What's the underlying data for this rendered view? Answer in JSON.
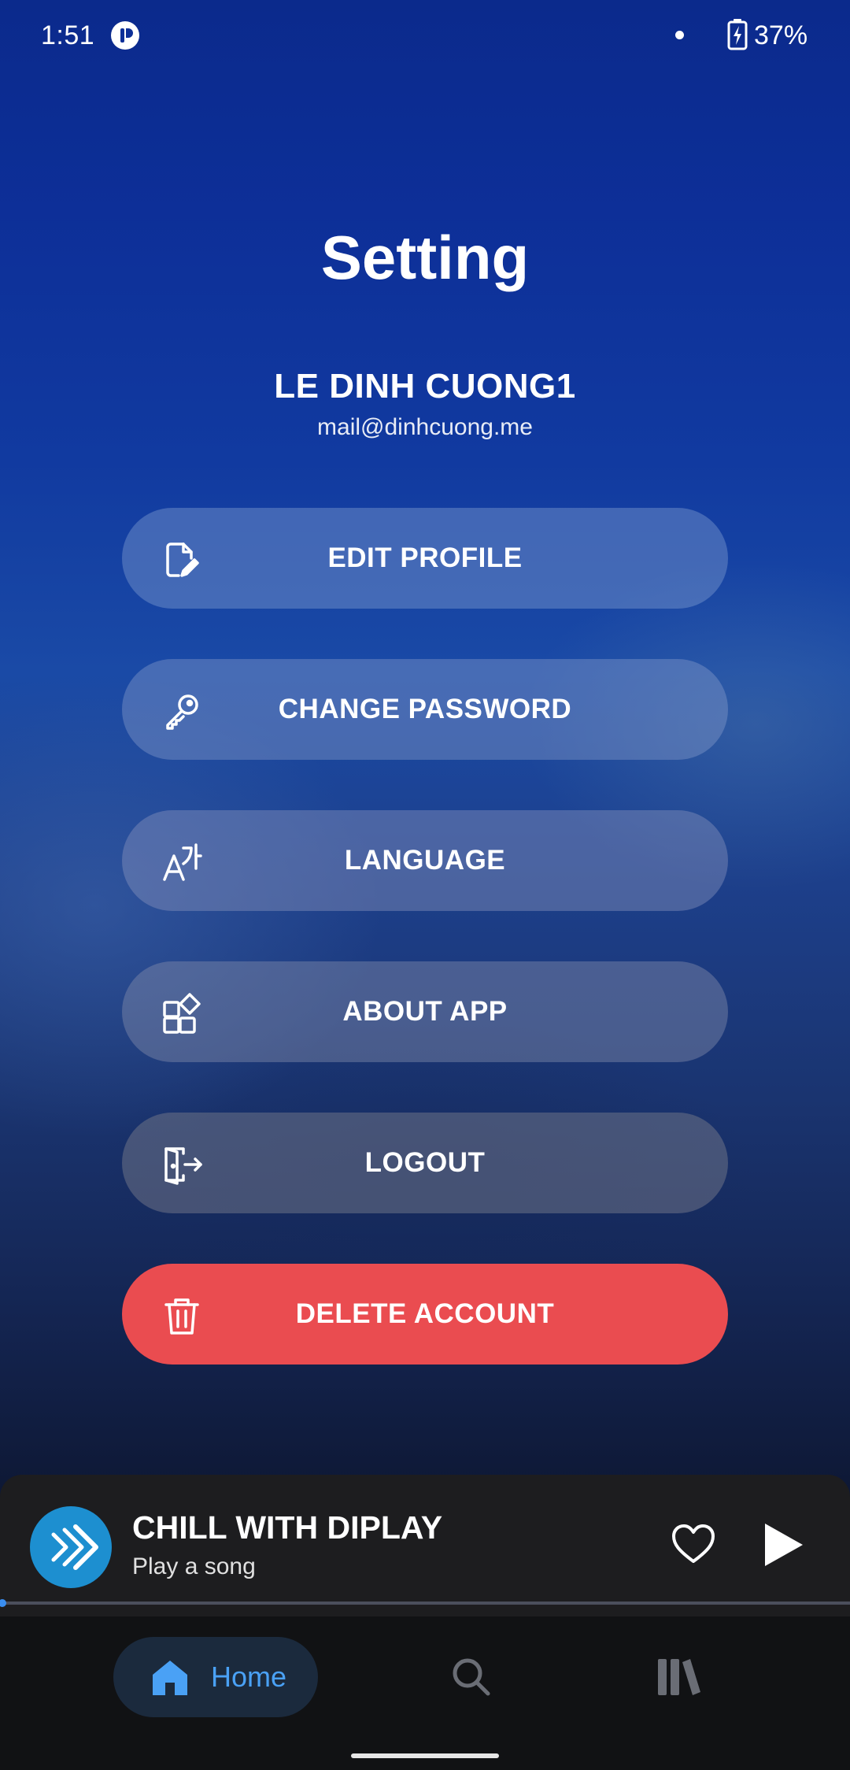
{
  "status_bar": {
    "time": "1:51",
    "battery": "37%",
    "icons": [
      "app-notification-icon",
      "dot-icon",
      "battery-charging-icon"
    ]
  },
  "page": {
    "title": "Setting"
  },
  "user": {
    "name": "LE DINH CUONG1",
    "email": "mail@dinhcuong.me"
  },
  "menu": {
    "items": [
      {
        "label": "EDIT PROFILE",
        "icon": "edit-document-icon"
      },
      {
        "label": "CHANGE PASSWORD",
        "icon": "key-icon"
      },
      {
        "label": "LANGUAGE",
        "icon": "translate-icon"
      },
      {
        "label": "ABOUT APP",
        "icon": "widgets-icon"
      },
      {
        "label": "LOGOUT",
        "icon": "logout-icon"
      },
      {
        "label": "DELETE ACCOUNT",
        "icon": "trash-icon"
      }
    ]
  },
  "player": {
    "title": "CHILL WITH DIPLAY",
    "subtitle": "Play a song",
    "progress": 0,
    "icons": [
      "app-logo-icon",
      "heart-icon",
      "play-icon"
    ]
  },
  "nav": {
    "items": [
      {
        "label": "Home",
        "icon": "home-icon",
        "selected": true
      },
      {
        "label": "",
        "icon": "search-icon",
        "selected": false
      },
      {
        "label": "",
        "icon": "library-icon",
        "selected": false
      }
    ]
  },
  "colors": {
    "accent_blue": "#4aa1f5",
    "danger_red": "#ea4c50",
    "player_bg": "#1d1d1f",
    "nav_bg": "#111214",
    "logo_blue": "#1d8fd0"
  }
}
